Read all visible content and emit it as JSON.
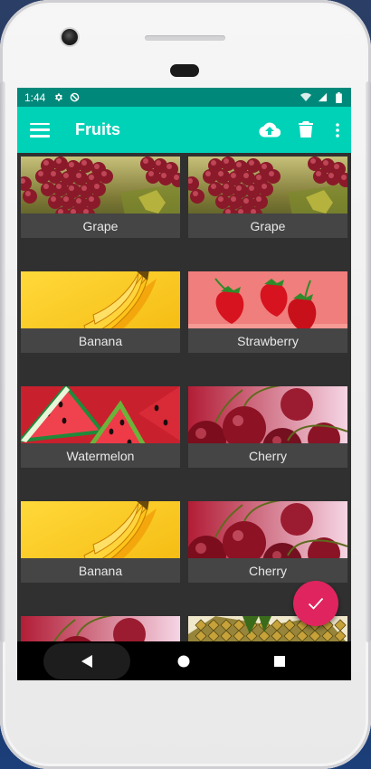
{
  "status_bar": {
    "time": "1:44",
    "icons": [
      "settings-icon",
      "do-not-disturb-icon",
      "wifi-icon",
      "signal-icon",
      "battery-icon"
    ]
  },
  "app_bar": {
    "title": "Fruits",
    "actions": [
      "cloud-upload-icon",
      "delete-icon",
      "more-vert-icon"
    ]
  },
  "grid": {
    "items": [
      {
        "label": "Grape",
        "image": "grape"
      },
      {
        "label": "Grape",
        "image": "grape"
      },
      {
        "label": "Banana",
        "image": "banana"
      },
      {
        "label": "Strawberry",
        "image": "strawberry"
      },
      {
        "label": "Watermelon",
        "image": "watermelon"
      },
      {
        "label": "Cherry",
        "image": "cherry"
      },
      {
        "label": "Banana",
        "image": "banana"
      },
      {
        "label": "Cherry",
        "image": "cherry"
      },
      {
        "label": "",
        "image": "cherry"
      },
      {
        "label": "",
        "image": "pineapple"
      }
    ]
  },
  "fab": {
    "icon": "check-icon",
    "color": "#e0245f"
  },
  "nav_bar": {
    "buttons": [
      "back-icon",
      "home-icon",
      "recents-icon"
    ]
  },
  "colors": {
    "primary": "#00d2b8",
    "primary_dark": "#00897b",
    "card_label_bg": "#454545",
    "background": "#303030"
  }
}
